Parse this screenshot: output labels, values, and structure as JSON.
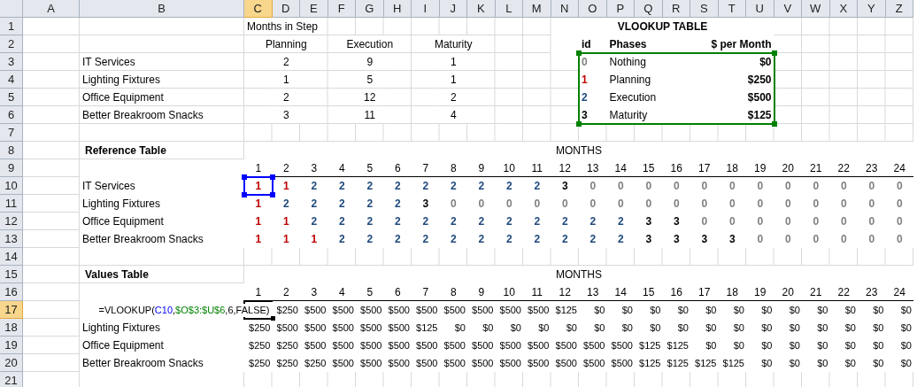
{
  "column_headers": [
    {
      "label": "A",
      "selected": false
    },
    {
      "label": "B",
      "selected": false
    },
    {
      "label": "C",
      "selected": true
    },
    {
      "label": "D",
      "selected": false
    },
    {
      "label": "E",
      "selected": false
    },
    {
      "label": "F",
      "selected": false
    },
    {
      "label": "G",
      "selected": false
    },
    {
      "label": "H",
      "selected": false
    },
    {
      "label": "I",
      "selected": false
    },
    {
      "label": "J",
      "selected": false
    },
    {
      "label": "K",
      "selected": false
    },
    {
      "label": "L",
      "selected": false
    },
    {
      "label": "M",
      "selected": false
    },
    {
      "label": "N",
      "selected": false
    },
    {
      "label": "O",
      "selected": false
    },
    {
      "label": "P",
      "selected": false
    },
    {
      "label": "Q",
      "selected": false
    },
    {
      "label": "R",
      "selected": false
    },
    {
      "label": "S",
      "selected": false
    },
    {
      "label": "T",
      "selected": false
    },
    {
      "label": "U",
      "selected": false
    },
    {
      "label": "V",
      "selected": false
    },
    {
      "label": "W",
      "selected": false
    },
    {
      "label": "X",
      "selected": false
    },
    {
      "label": "Y",
      "selected": false
    },
    {
      "label": "Z",
      "selected": false
    }
  ],
  "row_headers": [
    {
      "label": "1",
      "selected": false
    },
    {
      "label": "2",
      "selected": false
    },
    {
      "label": "3",
      "selected": false
    },
    {
      "label": "4",
      "selected": false
    },
    {
      "label": "5",
      "selected": false
    },
    {
      "label": "6",
      "selected": false
    },
    {
      "label": "7",
      "selected": false
    },
    {
      "label": "8",
      "selected": false
    },
    {
      "label": "9",
      "selected": false
    },
    {
      "label": "10",
      "selected": false
    },
    {
      "label": "11",
      "selected": false
    },
    {
      "label": "12",
      "selected": false
    },
    {
      "label": "13",
      "selected": false
    },
    {
      "label": "14",
      "selected": false
    },
    {
      "label": "15",
      "selected": false
    },
    {
      "label": "16",
      "selected": false
    },
    {
      "label": "17",
      "selected": true
    },
    {
      "label": "18",
      "selected": false
    },
    {
      "label": "19",
      "selected": false
    },
    {
      "label": "20",
      "selected": false
    },
    {
      "label": "21",
      "selected": false
    }
  ],
  "months_in_step": {
    "title": "Months in Step",
    "phases": [
      "Planning",
      "Execution",
      "Maturity"
    ],
    "rows": [
      {
        "name": "IT Services",
        "values": [
          "2",
          "9",
          "1"
        ]
      },
      {
        "name": "Lighting Fixtures",
        "values": [
          "1",
          "5",
          "1"
        ]
      },
      {
        "name": "Office Equipment",
        "values": [
          "2",
          "12",
          "2"
        ]
      },
      {
        "name": "Better Breakroom Snacks",
        "values": [
          "3",
          "11",
          "4"
        ]
      }
    ]
  },
  "vlookup_table": {
    "title": "VLOOKUP TABLE",
    "columns": [
      "id",
      "Phases",
      "$ per Month"
    ],
    "rows": [
      {
        "id": "0",
        "color": "#808080",
        "phase": "Nothing",
        "amount": "$0"
      },
      {
        "id": "1",
        "color": "#c00000",
        "phase": "Planning",
        "amount": "$250"
      },
      {
        "id": "2",
        "color": "#1f497d",
        "phase": "Execution",
        "amount": "$500"
      },
      {
        "id": "3",
        "color": "#000000",
        "phase": "Maturity",
        "amount": "$125"
      }
    ]
  },
  "reference_table": {
    "title": "Reference Table",
    "months_label": "MONTHS",
    "months": [
      "1",
      "2",
      "3",
      "4",
      "5",
      "6",
      "7",
      "8",
      "9",
      "10",
      "11",
      "12",
      "13",
      "14",
      "15",
      "16",
      "17",
      "18",
      "19",
      "20",
      "21",
      "22",
      "23",
      "24"
    ],
    "rows": [
      {
        "name": "IT Services",
        "values": [
          "1",
          "1",
          "2",
          "2",
          "2",
          "2",
          "2",
          "2",
          "2",
          "2",
          "2",
          "3",
          "0",
          "0",
          "0",
          "0",
          "0",
          "0",
          "0",
          "0",
          "0",
          "0",
          "0",
          "0"
        ]
      },
      {
        "name": "Lighting Fixtures",
        "values": [
          "1",
          "2",
          "2",
          "2",
          "2",
          "2",
          "3",
          "0",
          "0",
          "0",
          "0",
          "0",
          "0",
          "0",
          "0",
          "0",
          "0",
          "0",
          "0",
          "0",
          "0",
          "0",
          "0",
          "0"
        ]
      },
      {
        "name": "Office Equipment",
        "values": [
          "1",
          "1",
          "2",
          "2",
          "2",
          "2",
          "2",
          "2",
          "2",
          "2",
          "2",
          "2",
          "2",
          "2",
          "3",
          "3",
          "0",
          "0",
          "0",
          "0",
          "0",
          "0",
          "0",
          "0"
        ]
      },
      {
        "name": "Better Breakroom Snacks",
        "values": [
          "1",
          "1",
          "1",
          "2",
          "2",
          "2",
          "2",
          "2",
          "2",
          "2",
          "2",
          "2",
          "2",
          "2",
          "3",
          "3",
          "3",
          "3",
          "0",
          "0",
          "0",
          "0",
          "0",
          "0"
        ]
      }
    ]
  },
  "values_table": {
    "title": "Values Table",
    "months_label": "MONTHS",
    "months": [
      "1",
      "2",
      "3",
      "4",
      "5",
      "6",
      "7",
      "8",
      "9",
      "10",
      "11",
      "12",
      "13",
      "14",
      "15",
      "16",
      "17",
      "18",
      "19",
      "20",
      "21",
      "22",
      "23",
      "24"
    ],
    "formula_parts": [
      {
        "text": "=VLOOKUP("
      },
      {
        "text": "C10",
        "color": "#0000ff"
      },
      {
        "text": ","
      },
      {
        "text": "$O$3:$U$6",
        "color": "#008000"
      },
      {
        "text": ",6,FALSE)"
      }
    ],
    "rows": [
      {
        "values": [
          "$250",
          "$500",
          "$500",
          "$500",
          "$500",
          "$500",
          "$500",
          "$500",
          "$500",
          "$500",
          "$125",
          "$0",
          "$0",
          "$0",
          "$0",
          "$0",
          "$0",
          "$0",
          "$0",
          "$0",
          "$0",
          "$0",
          "$0"
        ]
      },
      {
        "name": "Lighting Fixtures",
        "values": [
          "$250",
          "$500",
          "$500",
          "$500",
          "$500",
          "$500",
          "$125",
          "$0",
          "$0",
          "$0",
          "$0",
          "$0",
          "$0",
          "$0",
          "$0",
          "$0",
          "$0",
          "$0",
          "$0",
          "$0",
          "$0",
          "$0",
          "$0",
          "$0"
        ]
      },
      {
        "name": "Office Equipment",
        "values": [
          "$250",
          "$250",
          "$500",
          "$500",
          "$500",
          "$500",
          "$500",
          "$500",
          "$500",
          "$500",
          "$500",
          "$500",
          "$500",
          "$500",
          "$125",
          "$125",
          "$0",
          "$0",
          "$0",
          "$0",
          "$0",
          "$0",
          "$0",
          "$0"
        ]
      },
      {
        "name": "Better Breakroom Snacks",
        "values": [
          "$250",
          "$250",
          "$250",
          "$500",
          "$500",
          "$500",
          "$500",
          "$500",
          "$500",
          "$500",
          "$500",
          "$500",
          "$500",
          "$500",
          "$125",
          "$125",
          "$125",
          "$125",
          "$0",
          "$0",
          "$0",
          "$0",
          "$0",
          "$0"
        ]
      }
    ]
  }
}
